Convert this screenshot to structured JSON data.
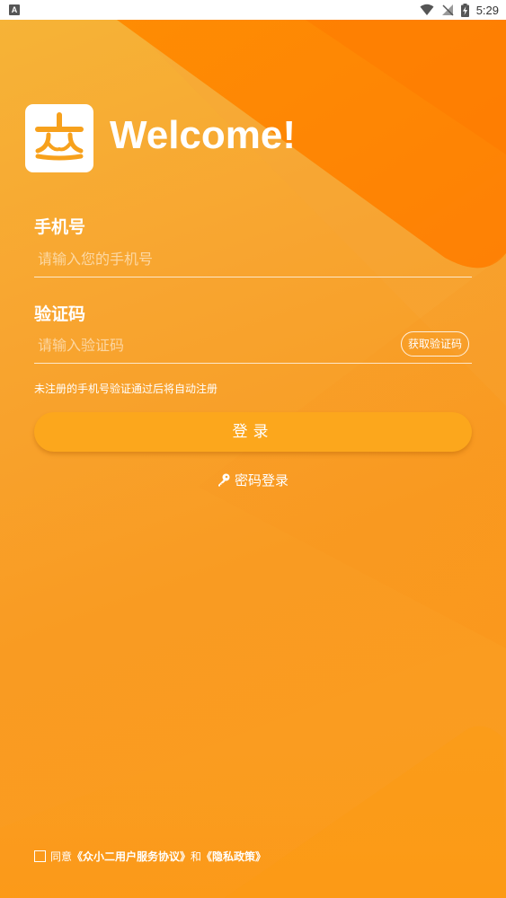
{
  "status_bar": {
    "app_badge": "A",
    "time": "5:29"
  },
  "header": {
    "welcome": "Welcome!"
  },
  "form": {
    "phone_label": "手机号",
    "phone_placeholder": "请输入您的手机号",
    "code_label": "验证码",
    "code_placeholder": "请输入验证码",
    "get_code_button": "获取验证码",
    "hint": "未注册的手机号验证通过后将自动注册",
    "login_button": "登录",
    "password_login": "密码登录"
  },
  "agreement": {
    "prefix": "同意",
    "service_link": "《众小二用户服务协议》",
    "and": "和",
    "privacy_link": "《隐私政策》",
    "checked": false
  },
  "colors": {
    "background": "#f8a530",
    "button": "#fca71c",
    "logo": "#f7a11c",
    "text": "#ffffff"
  }
}
